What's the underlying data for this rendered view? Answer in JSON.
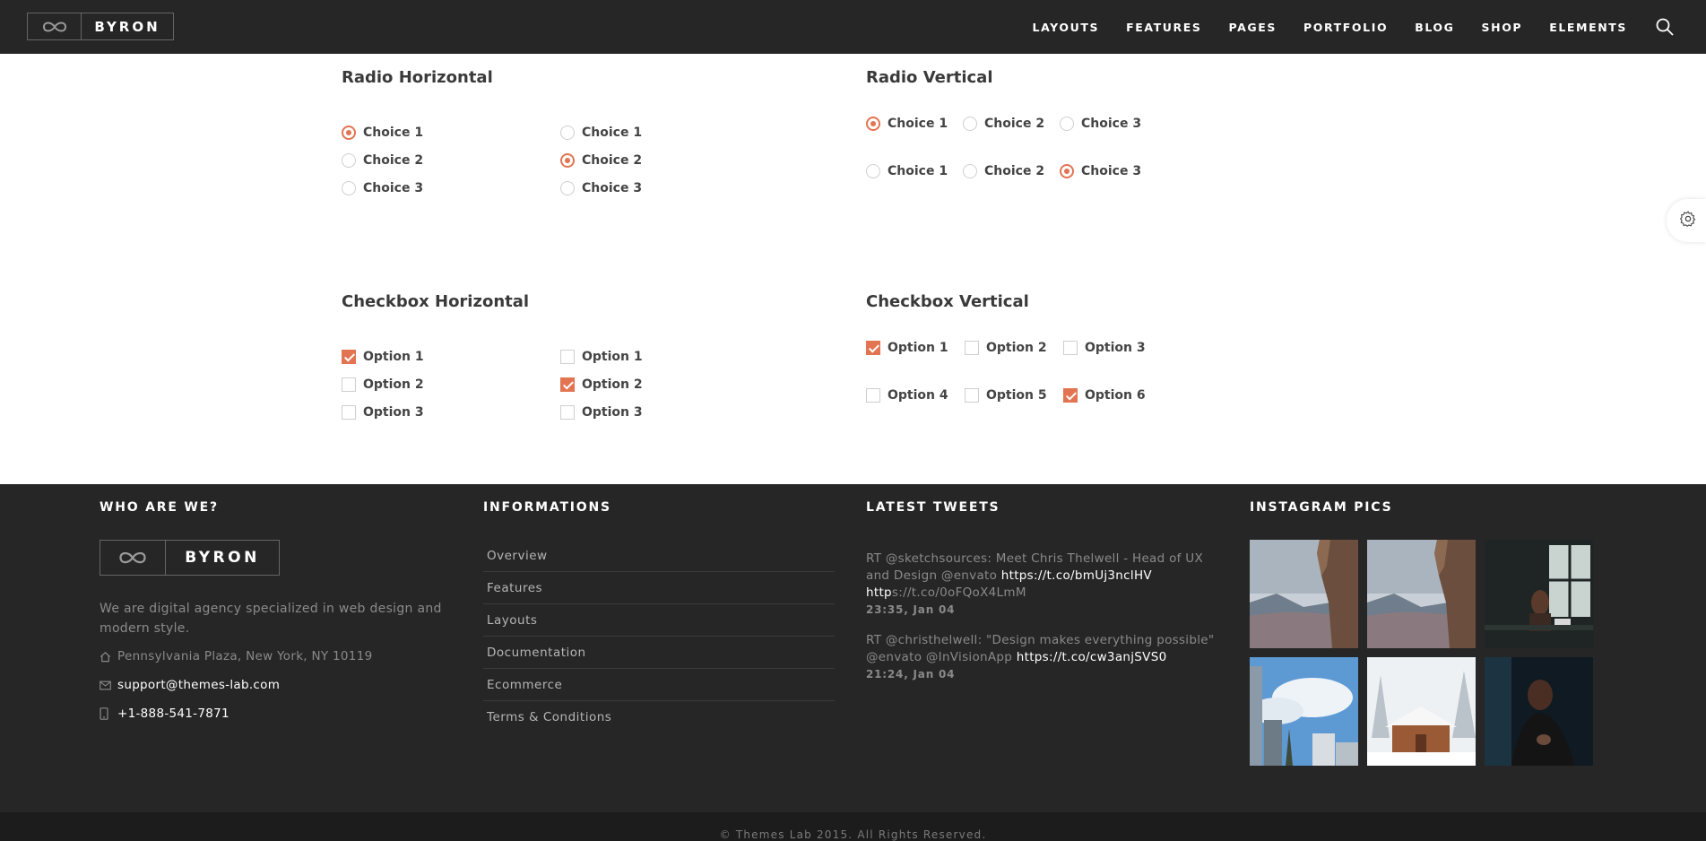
{
  "header": {
    "brand": "BYRON",
    "nav": [
      "LAYOUTS",
      "FEATURES",
      "PAGES",
      "PORTFOLIO",
      "BLOG",
      "SHOP",
      "ELEMENTS"
    ]
  },
  "forms": {
    "radio_horizontal": {
      "title": "Radio Horizontal",
      "col1": [
        {
          "label": "Choice 1",
          "checked": true
        },
        {
          "label": "Choice 2",
          "checked": false
        },
        {
          "label": "Choice 3",
          "checked": false
        }
      ],
      "col2": [
        {
          "label": "Choice 1",
          "checked": false
        },
        {
          "label": "Choice 2",
          "checked": true
        },
        {
          "label": "Choice 3",
          "checked": false
        }
      ]
    },
    "radio_vertical": {
      "title": "Radio Vertical",
      "row1": [
        {
          "label": "Choice 1",
          "checked": true
        },
        {
          "label": "Choice 2",
          "checked": false
        },
        {
          "label": "Choice 3",
          "checked": false
        }
      ],
      "row2": [
        {
          "label": "Choice 1",
          "checked": false
        },
        {
          "label": "Choice 2",
          "checked": false
        },
        {
          "label": "Choice 3",
          "checked": true
        }
      ]
    },
    "checkbox_horizontal": {
      "title": "Checkbox Horizontal",
      "col1": [
        {
          "label": "Option 1",
          "checked": true
        },
        {
          "label": "Option 2",
          "checked": false
        },
        {
          "label": "Option 3",
          "checked": false
        }
      ],
      "col2": [
        {
          "label": "Option 1",
          "checked": false
        },
        {
          "label": "Option 2",
          "checked": true
        },
        {
          "label": "Option 3",
          "checked": false
        }
      ]
    },
    "checkbox_vertical": {
      "title": "Checkbox Vertical",
      "row1": [
        {
          "label": "Option 1",
          "checked": true
        },
        {
          "label": "Option 2",
          "checked": false
        },
        {
          "label": "Option 3",
          "checked": false
        }
      ],
      "row2": [
        {
          "label": "Option 4",
          "checked": false
        },
        {
          "label": "Option 5",
          "checked": false
        },
        {
          "label": "Option 6",
          "checked": true
        }
      ]
    }
  },
  "footer": {
    "who": {
      "title": "WHO ARE WE?",
      "brand": "BYRON",
      "description": "We are digital agency specialized in web design and modern style.",
      "address": "Pennsylvania Plaza, New York, NY 10119",
      "email": "support@themes-lab.com",
      "phone": "+1-888-541-7871"
    },
    "informations": {
      "title": "INFORMATIONS",
      "links": [
        "Overview",
        "Features",
        "Layouts",
        "Documentation",
        "Ecommerce",
        "Terms & Conditions"
      ]
    },
    "tweets": {
      "title": "LATEST TWEETS",
      "items": [
        {
          "text": "RT @sketchsources: Meet Chris Thelwell - Head of UX and Design @envato ",
          "link": "https://t.co/bmUj3nclHV",
          "link2_strong": "http",
          "link2_rest": "s://t.co/0oFQoX4LmM",
          "time": "23:35, Jan 04"
        },
        {
          "text": "RT @christhelwell: \"Design makes everything possible\" @envato @InVisionApp ",
          "link": "https://t.co/cw3anjSVS0",
          "time": "21:24, Jan 04"
        }
      ]
    },
    "instagram": {
      "title": "INSTAGRAM PICS",
      "pics": [
        "cliff-lake",
        "cliff-lake",
        "dark-window-desk",
        "city-sky",
        "snow-cabin",
        "dark-portrait"
      ]
    },
    "copyright": "© Themes Lab 2015. All Rights Reserved."
  },
  "colors": {
    "accent": "#e27452",
    "header_bg": "#262626",
    "footer_bg": "#262626"
  }
}
